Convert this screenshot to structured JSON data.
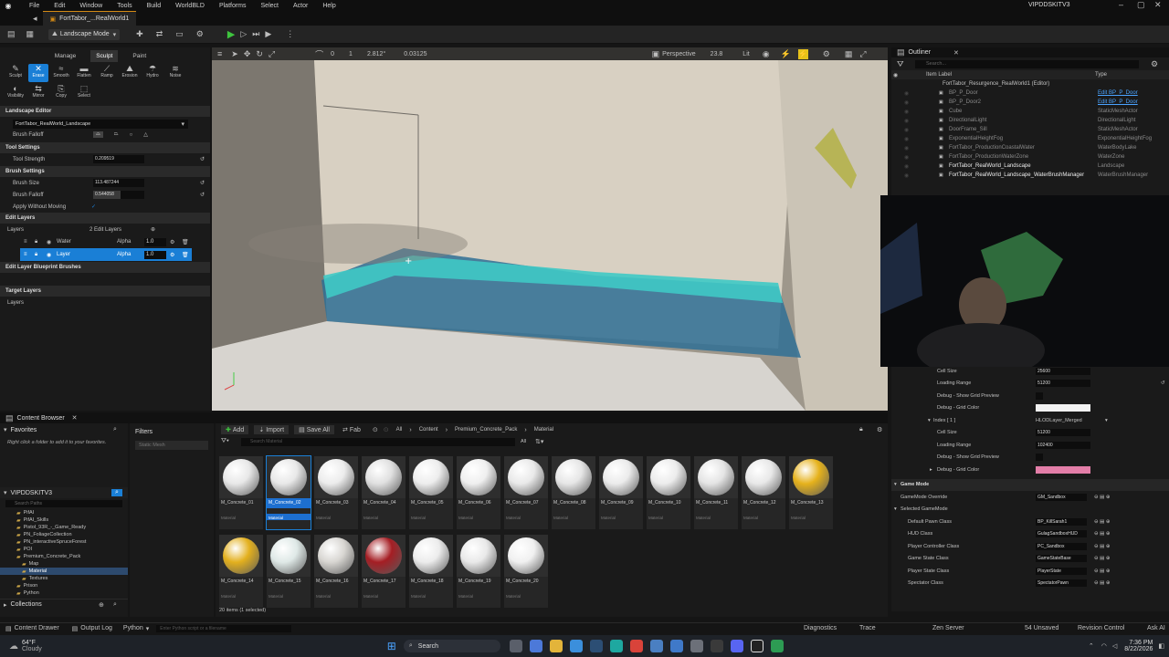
{
  "menu": [
    "File",
    "Edit",
    "Window",
    "Tools",
    "Build",
    "Select",
    "Actor",
    "Help"
  ],
  "worldbld": "WorldBLD",
  "platforms": "Platforms",
  "account": "VIPDDSKITV3",
  "tab_title": "FortTabor_...RealWorld1",
  "mode": "Landscape Mode",
  "sculpt_tabs": [
    "Manage",
    "Sculpt",
    "Paint"
  ],
  "tools_row1": [
    "Sculpt",
    "Erase",
    "Smooth",
    "Flatten",
    "Ramp",
    "Erosion",
    "Hydro",
    "Noise"
  ],
  "tools_row2": [
    "Visibility",
    "Mirror",
    "Copy",
    "Select"
  ],
  "landscape_editor": "Landscape Editor",
  "landscape_select": "FortTabor_RealWorld_Landscape",
  "brush_falloff": "Brush Falloff",
  "tool_settings": "Tool Settings",
  "tool_strength_label": "Tool Strength",
  "tool_strength": "0.209519",
  "brush_settings": "Brush Settings",
  "brush_size_label": "Brush Size",
  "brush_size": "113.487244",
  "brush_falloff_label": "Brush Falloff",
  "brush_falloff_val": "0.544058",
  "apply_without_moving": "Apply Without Moving",
  "edit_layers": "Edit Layers",
  "layers_label": "Layers",
  "edit_layers_count": "2 Edit Layers",
  "layer_rows": [
    {
      "name": "Water",
      "alpha_label": "Alpha",
      "alpha": "1.0"
    },
    {
      "name": "Layer",
      "alpha_label": "Alpha",
      "alpha": "1.0"
    }
  ],
  "blueprint_brushes": "Edit Layer Blueprint Brushes",
  "target_layers": "Target Layers",
  "target_layers_sub": "Layers",
  "viewport": {
    "perspective": "Perspective",
    "fov": "23.8",
    "lit": "Lit",
    "snap1": "0",
    "snap2": "1",
    "rot": "2.812°",
    "scale": "0.03125"
  },
  "outliner": {
    "title": "Outliner",
    "search": "Search...",
    "col_label": "Item Label",
    "col_type": "Type",
    "root": "FortTabor_Resurgence_RealWorld1 (Editor)",
    "rows": [
      {
        "label": "BP_P_Door",
        "type": "Edit BP_P_Door"
      },
      {
        "label": "BP_P_Door2",
        "type": "Edit BP_P_Door"
      },
      {
        "label": "Cube",
        "type": "StaticMeshActor"
      },
      {
        "label": "DirectionalLight",
        "type": "DirectionalLight"
      },
      {
        "label": "DoorFrame_Sill",
        "type": "StaticMeshActor"
      },
      {
        "label": "ExponentialHeightFog",
        "type": "ExponentialHeightFog"
      },
      {
        "label": "FortTabor_ProductionCoastalWater",
        "type": "WaterBodyLake"
      },
      {
        "label": "FortTabor_ProductionWaterZone",
        "type": "WaterZone"
      },
      {
        "label": "FortTabor_RealWorld_Landscape",
        "type": "Landscape"
      },
      {
        "label": "FortTabor_RealWorld_Landscape_WaterBrushManager",
        "type": "WaterBrushManager"
      }
    ]
  },
  "details": {
    "cell_size_label": "Cell Size",
    "cell_size": "25600",
    "loading_range_label": "Loading Range",
    "loading_range": "51200",
    "debug_preview": "Debug - Show Grid Preview",
    "debug_color": "Debug - Grid Color",
    "index_label": "Index [ 1 ]",
    "hlod": "HLODLayer_Merged",
    "cell_size2": "51200",
    "loading_range2": "102400",
    "debug_color2_label": "Debug - Grid Color",
    "game_mode": "Game Mode",
    "game_mode_override_label": "GameMode Override",
    "game_mode_override": "GM_Sandbox",
    "selected_game_mode": "Selected GameMode",
    "props": [
      {
        "label": "Default Pawn Class",
        "value": "BP_KillSarah1"
      },
      {
        "label": "HUD Class",
        "value": "GulagSandboxHUD"
      },
      {
        "label": "Player Controller Class",
        "value": "PC_Sandbox"
      },
      {
        "label": "Game State Class",
        "value": "GameStateBase"
      },
      {
        "label": "Player State Class",
        "value": "PlayerState"
      },
      {
        "label": "Spectator Class",
        "value": "SpectatorPawn"
      }
    ]
  },
  "content_browser": {
    "tab": "Content Browser",
    "favorites": "Favorites",
    "fav_hint": "Right click a folder to add it to your favorites.",
    "filters": "Filters",
    "filter_chip": "Static Mesh",
    "add": "Add",
    "import": "Import",
    "save_all": "Save All",
    "fab": "Fab",
    "crumbs": [
      "All",
      "Content",
      "Premium_Concrete_Pack",
      "Material"
    ],
    "search": "Search Material",
    "search_paths": "Search Paths",
    "all_label": "All",
    "project": "VIPDDSKITV3",
    "tree": [
      "PifAI",
      "PifAI_Skills",
      "Pistol_93R_-_Game_Ready",
      "PN_FoliageCollection",
      "PN_interactiveSpruceForest",
      "POI",
      "Premium_Concrete_Pack",
      "Map",
      "Material",
      "Textures",
      "Prison",
      "Python"
    ],
    "collections": "Collections",
    "count": "20 items (1 selected)",
    "items": [
      {
        "name": "M_Concrete_01",
        "kind": "Material"
      },
      {
        "name": "M_Concrete_02",
        "kind": "Material"
      },
      {
        "name": "M_Concrete_03",
        "kind": "Material"
      },
      {
        "name": "M_Concrete_04",
        "kind": "Material"
      },
      {
        "name": "M_Concrete_05",
        "kind": "Material"
      },
      {
        "name": "M_Concrete_06",
        "kind": "Material"
      },
      {
        "name": "M_Concrete_07",
        "kind": "Material"
      },
      {
        "name": "M_Concrete_08",
        "kind": "Material"
      },
      {
        "name": "M_Concrete_09",
        "kind": "Material"
      },
      {
        "name": "M_Concrete_10",
        "kind": "Material"
      },
      {
        "name": "M_Concrete_11",
        "kind": "Material"
      },
      {
        "name": "M_Concrete_12",
        "kind": "Material"
      },
      {
        "name": "M_Concrete_13",
        "kind": "Material"
      },
      {
        "name": "M_Concrete_14",
        "kind": "Material"
      },
      {
        "name": "M_Concrete_15",
        "kind": "Material"
      },
      {
        "name": "M_Concrete_16",
        "kind": "Material"
      },
      {
        "name": "M_Concrete_17",
        "kind": "Material"
      },
      {
        "name": "M_Concrete_18",
        "kind": "Material"
      },
      {
        "name": "M_Concrete_19",
        "kind": "Material"
      },
      {
        "name": "M_Concrete_20",
        "kind": "Material"
      }
    ],
    "sphere_colors": [
      "#e8e8e8",
      "#e8e8e8",
      "#ececec",
      "#e0e0e0",
      "#ededed",
      "#efefef",
      "#e9e9e9",
      "#e6e6e6",
      "#ebebeb",
      "#ececec",
      "#e4e4e4",
      "#e8e8e8",
      "#e6b21c",
      "#e3b01e",
      "#dfe9e7",
      "#d8d6d2",
      "#a51e24",
      "#ececec",
      "#e9e9e9",
      "#f0f0f0"
    ]
  },
  "statusbar": {
    "drawer": "Content Drawer",
    "output": "Output Log",
    "python": "Python",
    "cmd_placeholder": "Enter Python script or a filename",
    "diagnostics": "Diagnostics",
    "trace": "Trace",
    "zen": "Zen Server",
    "unsaved": "54 Unsaved",
    "revision": "Revision Control",
    "askai": "Ask AI"
  },
  "taskbar": {
    "temp": "64°F",
    "weather": "Cloudy",
    "search": "Search",
    "time": "7:36 PM",
    "date": "8/22/2026"
  },
  "colors": {
    "accent": "#1a7fd6",
    "selected_tile": "#1d6fd0",
    "grid_color1": "#f2f2f2",
    "grid_color2": "#e37ea8",
    "water": "#3fc9c5"
  }
}
